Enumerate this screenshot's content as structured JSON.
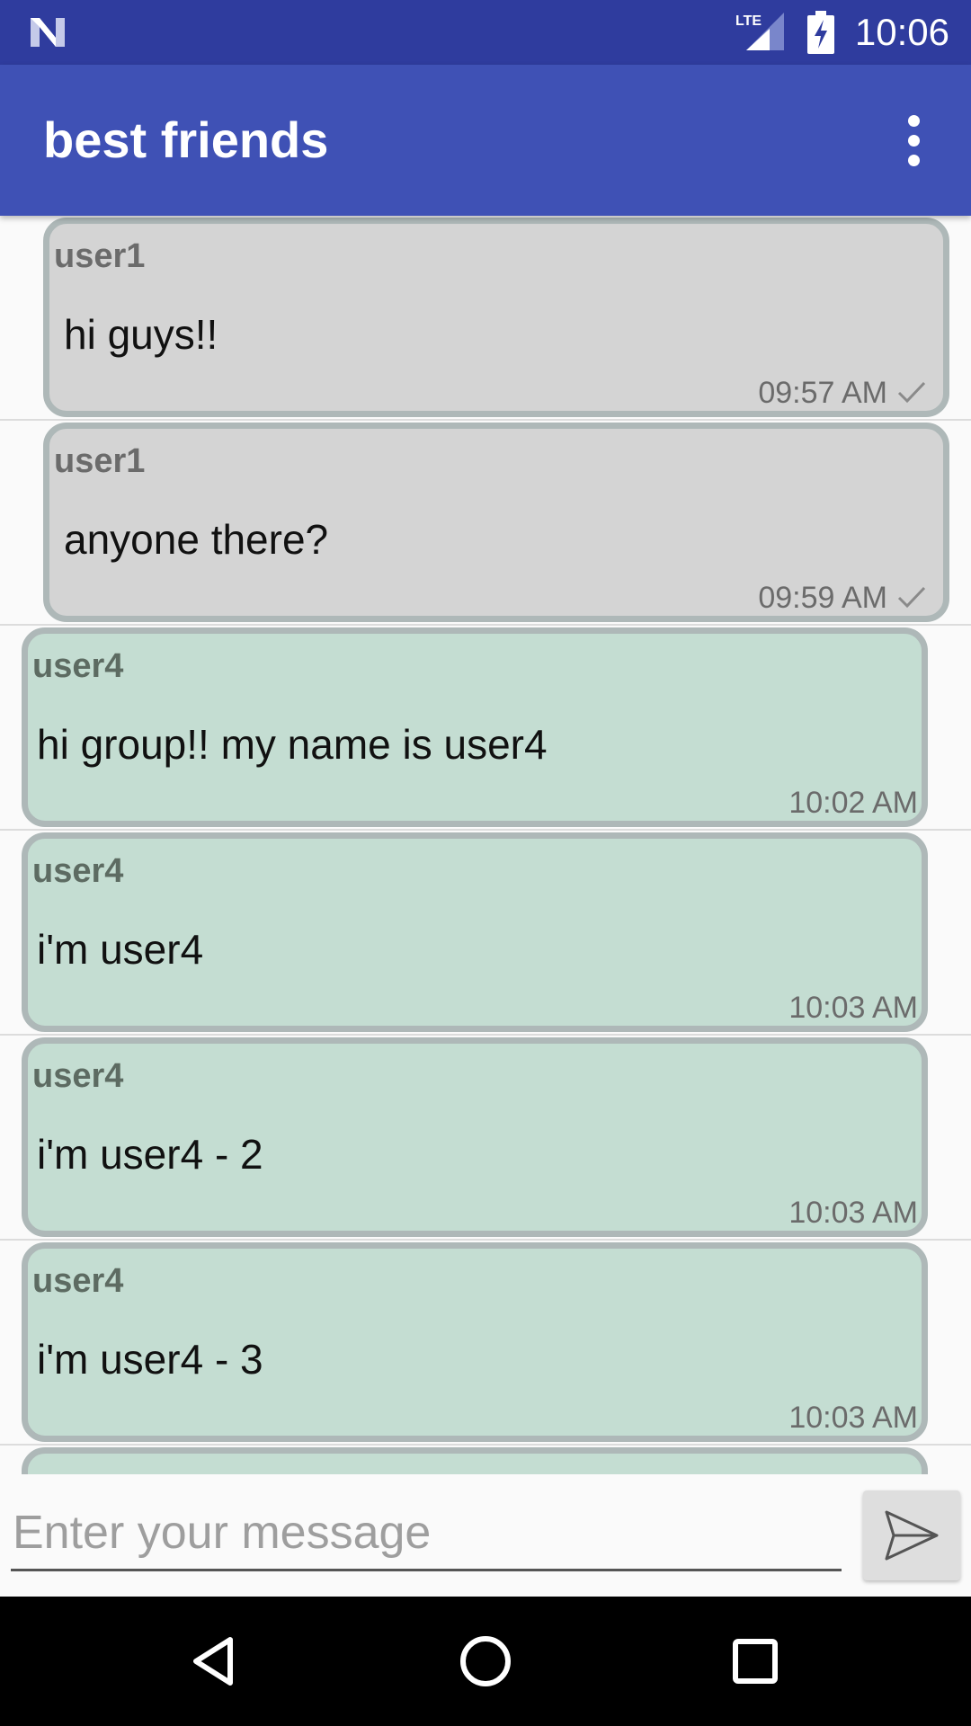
{
  "status_bar": {
    "time": "10:06",
    "network": "LTE",
    "icons": [
      "n-logo-icon",
      "lte-signal-icon",
      "battery-charging-icon"
    ]
  },
  "app_bar": {
    "title": "best friends",
    "menu_icon": "more-vert-icon"
  },
  "messages": [
    {
      "sender": "user1",
      "text": "hi guys!!",
      "time": "09:57 AM",
      "type": "other",
      "read": true
    },
    {
      "sender": "user1",
      "text": "anyone there?",
      "time": "09:59 AM",
      "type": "other",
      "read": true
    },
    {
      "sender": "user4",
      "text": "hi group!! my name is user4",
      "time": "10:02 AM",
      "type": "mine",
      "read": false
    },
    {
      "sender": "user4",
      "text": "i'm user4",
      "time": "10:03 AM",
      "type": "mine",
      "read": false
    },
    {
      "sender": "user4",
      "text": "i'm user4 - 2",
      "time": "10:03 AM",
      "type": "mine",
      "read": false
    },
    {
      "sender": "user4",
      "text": "i'm user4 - 3",
      "time": "10:03 AM",
      "type": "mine",
      "read": false
    }
  ],
  "composer": {
    "placeholder": "Enter your message",
    "value": "",
    "send_icon": "send-icon"
  },
  "colors": {
    "status_bar": "#2f3c9e",
    "app_bar": "#3f51b5",
    "bubble_other": "#d4d4d4",
    "bubble_mine": "#c4ddd2",
    "bubble_border": "#aeb8b8"
  },
  "nav_bar": {
    "icons": [
      "back-icon",
      "home-icon",
      "recents-icon"
    ]
  }
}
